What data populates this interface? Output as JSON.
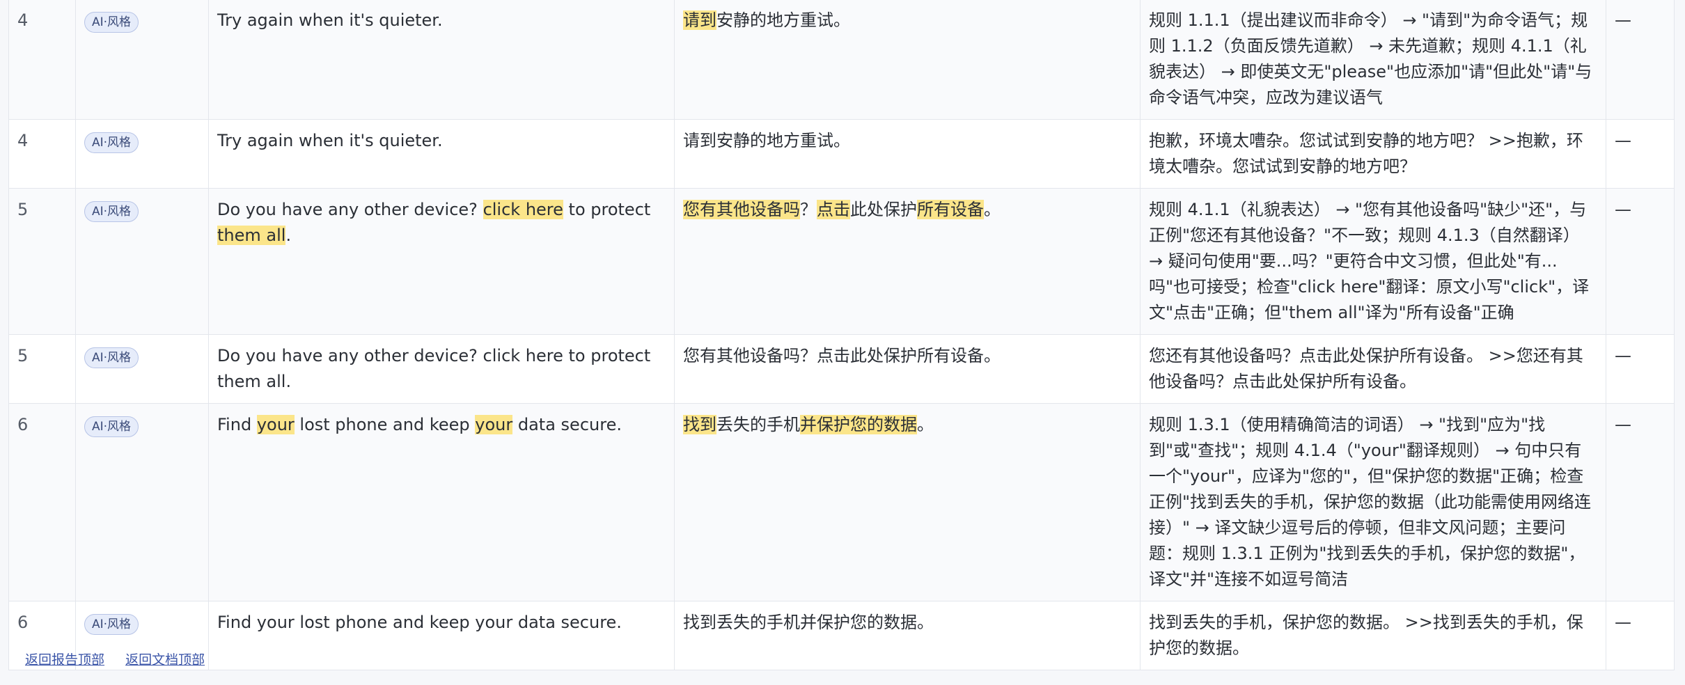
{
  "rows": [
    {
      "num": "4",
      "badge": "AI·风格",
      "source": [
        {
          "t": "Try again when it's quieter.",
          "h": false
        }
      ],
      "target": [
        {
          "t": "请到",
          "h": true
        },
        {
          "t": "安静的地方重试。",
          "h": false
        }
      ],
      "note": "规则 1.1.1（提出建议而非命令） → \"请到\"为命令语气；规则 1.1.2（负面反馈先道歉） → 未先道歉；规则 4.1.1（礼貌表达） → 即使英文无\"please\"也应添加\"请\"但此处\"请\"与命令语气冲突，应改为建议语气",
      "flag": "—"
    },
    {
      "num": "4",
      "badge": "AI·风格",
      "source": [
        {
          "t": "Try again when it's quieter.",
          "h": false
        }
      ],
      "target": [
        {
          "t": "请到安静的地方重试。",
          "h": false
        }
      ],
      "note": "抱歉，环境太嘈杂。您试试到安静的地方吧？ >>抱歉，环境太嘈杂。您试试到安静的地方吧？",
      "flag": "—"
    },
    {
      "num": "5",
      "badge": "AI·风格",
      "source": [
        {
          "t": "Do you have any other device? ",
          "h": false
        },
        {
          "t": "click here",
          "h": true
        },
        {
          "t": " to protect ",
          "h": false
        },
        {
          "t": "them all",
          "h": true
        },
        {
          "t": ".",
          "h": false
        }
      ],
      "target": [
        {
          "t": "您有其他设备吗",
          "h": true
        },
        {
          "t": "？",
          "h": false
        },
        {
          "t": "点击",
          "h": true
        },
        {
          "t": "此处保护",
          "h": false
        },
        {
          "t": "所有设备",
          "h": true
        },
        {
          "t": "。",
          "h": false
        }
      ],
      "note": "规则 4.1.1（礼貌表达） → \"您有其他设备吗\"缺少\"还\"，与正例\"您还有其他设备？\"不一致；规则 4.1.3（自然翻译） → 疑问句使用\"要...吗？\"更符合中文习惯，但此处\"有...吗\"也可接受；检查\"click here\"翻译：原文小写\"click\"，译文\"点击\"正确；但\"them all\"译为\"所有设备\"正确",
      "flag": "—"
    },
    {
      "num": "5",
      "badge": "AI·风格",
      "source": [
        {
          "t": "Do you have any other device? click here to protect them all.",
          "h": false
        }
      ],
      "target": [
        {
          "t": "您有其他设备吗？点击此处保护所有设备。",
          "h": false
        }
      ],
      "note": "您还有其他设备吗？点击此处保护所有设备。 >>您还有其他设备吗？点击此处保护所有设备。",
      "flag": "—"
    },
    {
      "num": "6",
      "badge": "AI·风格",
      "source": [
        {
          "t": "Find ",
          "h": false
        },
        {
          "t": "your",
          "h": true
        },
        {
          "t": " lost phone and keep ",
          "h": false
        },
        {
          "t": "your",
          "h": true
        },
        {
          "t": " data secure.",
          "h": false
        }
      ],
      "target": [
        {
          "t": "找到",
          "h": true
        },
        {
          "t": "丢失的手机",
          "h": false
        },
        {
          "t": "并保护您的数据",
          "h": true
        },
        {
          "t": "。",
          "h": false
        }
      ],
      "note": "规则 1.3.1（使用精确简洁的词语） → \"找到\"应为\"找到\"或\"查找\"；规则 4.1.4（\"your\"翻译规则） → 句中只有一个\"your\"，应译为\"您的\"，但\"保护您的数据\"正确；检查正例\"找到丢失的手机，保护您的数据（此功能需使用网络连接）\" → 译文缺少逗号后的停顿，但非文风问题；主要问题：规则 1.3.1 正例为\"找到丢失的手机，保护您的数据\"，译文\"并\"连接不如逗号简洁",
      "flag": "—"
    },
    {
      "num": "6",
      "badge": "AI·风格",
      "source": [
        {
          "t": "Find your lost phone and keep your data secure.",
          "h": false
        }
      ],
      "target": [
        {
          "t": "找到丢失的手机并保护您的数据。",
          "h": false
        }
      ],
      "note": "找到丢失的手机，保护您的数据。 >>找到丢失的手机，保护您的数据。",
      "flag": "—"
    }
  ],
  "footer": {
    "back_to_report_top": "返回报告顶部",
    "back_to_doc_top": "返回文档顶部"
  }
}
